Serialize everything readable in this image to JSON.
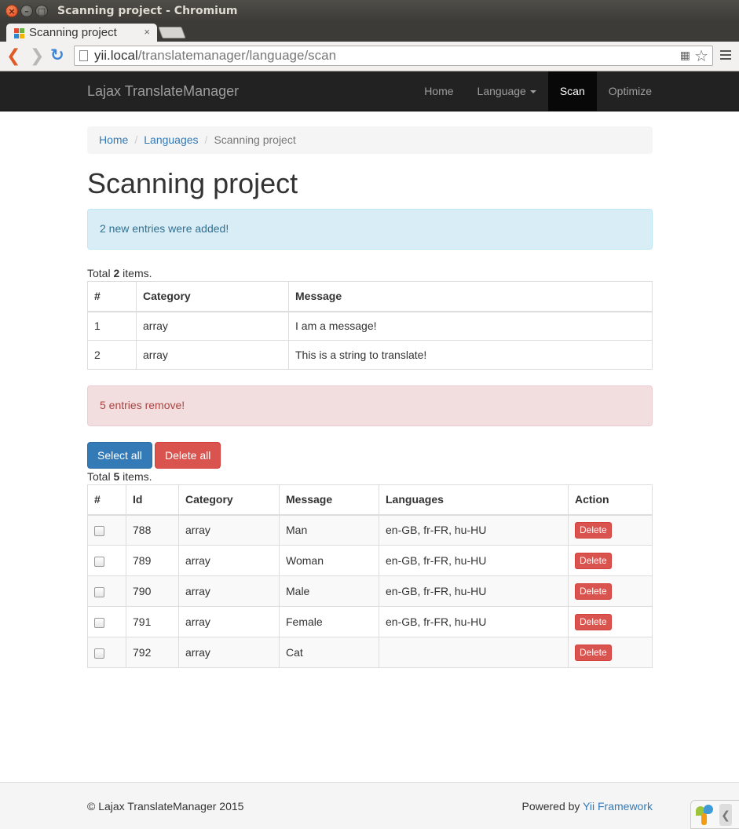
{
  "window": {
    "title": "Scanning project - Chromium"
  },
  "tab": {
    "title": "Scanning project",
    "close": "×"
  },
  "toolbar": {
    "url_host": "yii.local",
    "url_path": "/translatemanager/language/scan"
  },
  "navbar": {
    "brand": "Lajax TranslateManager",
    "links": [
      {
        "label": "Home"
      },
      {
        "label": "Language"
      },
      {
        "label": "Scan"
      },
      {
        "label": "Optimize"
      }
    ]
  },
  "breadcrumb": {
    "home": "Home",
    "languages": "Languages",
    "current": "Scanning project",
    "separator": "/"
  },
  "page": {
    "title": "Scanning project"
  },
  "alerts": {
    "added": "2 new entries were added!",
    "removed": "5 entries remove!"
  },
  "added_table": {
    "summary_prefix": "Total ",
    "summary_count": "2",
    "summary_suffix": " items.",
    "headers": [
      "#",
      "Category",
      "Message"
    ],
    "rows": [
      {
        "num": "1",
        "category": "array",
        "message": "I am a message!"
      },
      {
        "num": "2",
        "category": "array",
        "message": "This is a string to translate!"
      }
    ]
  },
  "buttons": {
    "select_all": "Select all",
    "delete_all": "Delete all"
  },
  "removed_table": {
    "summary_prefix": "Total ",
    "summary_count": "5",
    "summary_suffix": " items.",
    "headers": [
      "#",
      "Id",
      "Category",
      "Message",
      "Languages",
      "Action"
    ],
    "delete_label": "Delete",
    "rows": [
      {
        "id": "788",
        "category": "array",
        "message": "Man",
        "languages": "en-GB, fr-FR, hu-HU"
      },
      {
        "id": "789",
        "category": "array",
        "message": "Woman",
        "languages": "en-GB, fr-FR, hu-HU"
      },
      {
        "id": "790",
        "category": "array",
        "message": "Male",
        "languages": "en-GB, fr-FR, hu-HU"
      },
      {
        "id": "791",
        "category": "array",
        "message": "Female",
        "languages": "en-GB, fr-FR, hu-HU"
      },
      {
        "id": "792",
        "category": "array",
        "message": "Cat",
        "languages": ""
      }
    ]
  },
  "footer": {
    "copyright": "© Lajax TranslateManager 2015",
    "powered_prefix": "Powered by ",
    "powered_link": "Yii Framework"
  },
  "colors": {
    "primary": "#337ab7",
    "danger": "#d9534f",
    "navbar": "#222222",
    "info_bg": "#d9edf7",
    "danger_bg": "#f2dede"
  },
  "icons": {
    "back": "back-icon",
    "forward": "forward-icon",
    "reload": "reload-icon",
    "page": "page-icon",
    "translate": "translate-icon",
    "star": "star-icon",
    "menu": "menu-icon",
    "caret": "caret-down-icon",
    "yii": "yii-logo-icon",
    "collapse": "chevron-left-icon"
  }
}
